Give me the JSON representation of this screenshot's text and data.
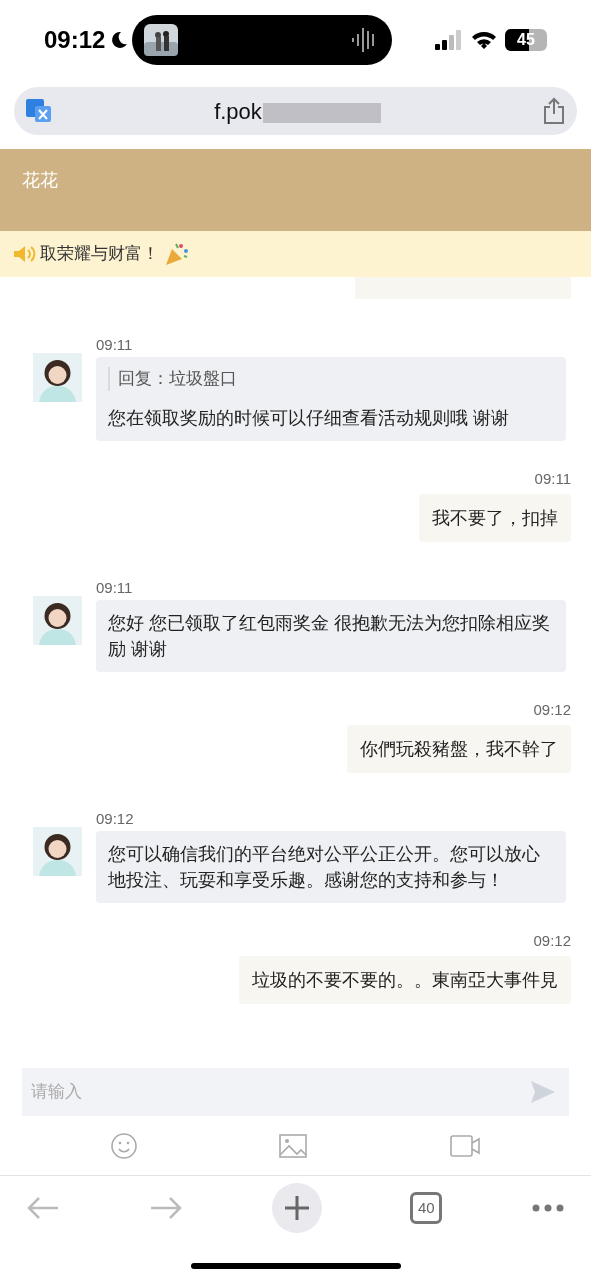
{
  "status_bar": {
    "time": "09:12",
    "battery": "45"
  },
  "address_bar": {
    "url": "f.pok"
  },
  "header": {
    "title": "花花"
  },
  "notice": {
    "text": "​取荣耀与财富！"
  },
  "messages": [
    {
      "kind": "partial"
    },
    {
      "kind": "agent",
      "time": "09:11",
      "reply_to": "回复：垃圾盤口",
      "text": "您在领取奖励的时候可以仔细查看活动规则哦 谢谢"
    },
    {
      "kind": "user",
      "time": "09:11",
      "text": "我不要了，扣掉"
    },
    {
      "kind": "agent",
      "time": "09:11",
      "text": "您好 您已领取了红包雨奖金 很抱歉无法为您扣除相应奖励 谢谢"
    },
    {
      "kind": "user",
      "time": "09:12",
      "text": "你們玩殺豬盤，我不幹了"
    },
    {
      "kind": "agent",
      "time": "09:12",
      "text": "您可以确信我们的平台绝对公平公正公开。您可以放心地投注、玩耍和享受乐趣。感谢您的支持和参与！"
    },
    {
      "kind": "user",
      "time": "09:12",
      "text": "垃圾的不要不要的。。東南亞大事件見"
    }
  ],
  "composer": {
    "placeholder": "请输入"
  },
  "toolbar": {
    "tab_count": "40"
  }
}
